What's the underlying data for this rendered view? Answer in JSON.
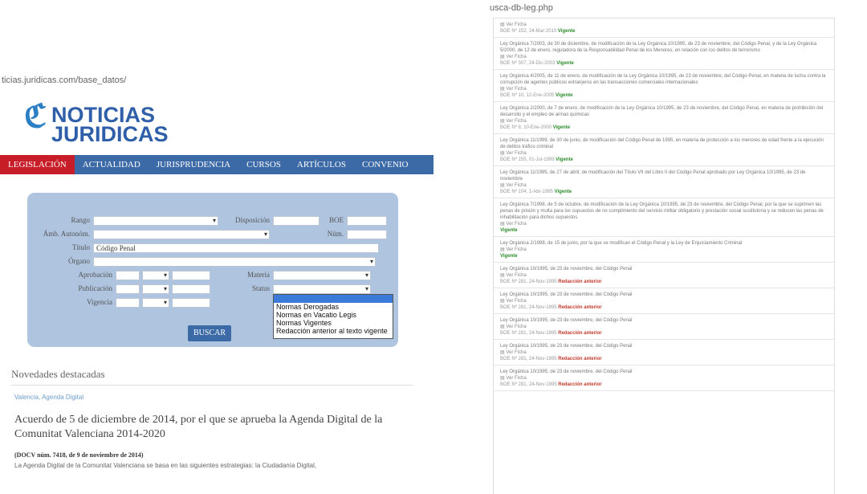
{
  "left_page": {
    "url": "ticias.juridicas.com/base_datos/",
    "logo": {
      "line1": "NOTICIAS",
      "line2": "JURIDICAS"
    },
    "nav": [
      "LEGISLACIÓN",
      "ACTUALIDAD",
      "JURISPRUDENCIA",
      "CURSOS",
      "ARTÍCULOS",
      "CONVENIO"
    ],
    "form": {
      "rango": "Rango",
      "disposicion": "Disposición",
      "boe": "BOE",
      "amb_autonomo": "Ámb. Autonóm.",
      "num": "Núm.",
      "titulo": "Título",
      "titulo_value": "Código Penal",
      "organo": "Órgano",
      "aprobacion": "Aprobación",
      "materia": "Materia",
      "publicacion": "Publicación",
      "status": "Status",
      "vigencia": "Vigencia",
      "status_options": [
        "Normas Derogadas",
        "Normas en Vacatio Legis",
        "Normas Vigentes",
        "Redacción anterior al texto vigente"
      ],
      "search_button": "BUSCAR"
    },
    "news_heading": "Novedades destacadas",
    "tag": "Valencia, Agenda Digital",
    "article_title": "Acuerdo de 5 de diciembre de 2014, por el que se aprueba la Agenda Digital de la Comunitat Valenciana 2014-2020",
    "article_source": "(DOCV núm. 7418, de 9 de noviembre de 2014)",
    "article_excerpt": "La Agenda Digital de la Comunitat Valenciana se basa en las siguientes estrategias: la Ciudadanía Digital,"
  },
  "right_page": {
    "url": "usca-db-leg.php",
    "badge_colors": {
      "vigente": "#2c8c2c",
      "anterior": "#c0392b"
    },
    "entries": [
      {
        "title": "",
        "file": "Ver Ficha",
        "meta": "BOE Nº 152, 24-Mar-2010",
        "badge": "Vigente",
        "badge_type": "vigente"
      },
      {
        "title": "Ley Orgánica 7/2003, de 30 de diciembre, de modificación de la Ley Orgánica 10/1995, de 23 de noviembre, del Código Penal, y de la Ley Orgánica 5/2000, de 12 de enero, reguladora de la Responsabilidad Penal de los Menores, en relación con los delitos de terrorismo",
        "file": "Ver Ficha",
        "meta": "BOE Nº 307, 24-Dic-2003",
        "badge": "Vigente",
        "badge_type": "vigente"
      },
      {
        "title": "Ley Orgánica 4/2005, de 11 de enero, de modificación de la Ley Orgánica 10/1995, de 23 de noviembre, del Código Penal, en materia de lucha contra la corrupción de agentes públicos extranjeros en las transacciones comerciales internacionales",
        "file": "Ver Ficha",
        "meta": "BOE Nº 10, 12-Ene-2005",
        "badge": "Vigente",
        "badge_type": "vigente"
      },
      {
        "title": "Ley Orgánica 2/2000, de 7 de enero, de modificación de la Ley Orgánica 10/1995, de 23 de noviembre, del Código Penal, en materia de prohibición del desarrollo y el empleo de armas químicas",
        "file": "Ver Ficha",
        "meta": "BOE Nº 8, 10-Ene-2000",
        "badge": "Vigente",
        "badge_type": "vigente"
      },
      {
        "title": "Ley Orgánica 11/1999, de 30 de junio, de modificación del Código Penal de 1995, en materia de protección a los menores de edad frente a la ejecución de delitos tráfico criminal",
        "file": "Ver Ficha",
        "meta": "BOE Nº 155, 01-Jul-1999",
        "badge": "Vigente",
        "badge_type": "vigente"
      },
      {
        "title": "Ley Orgánica 11/1995, de 27 de abril, de modificación del Título VII del Libro II del Código Penal aprobado por Ley Orgánica 10/1995, de 23 de noviembre",
        "file": "Ver Ficha",
        "meta": "BOE Nº 104, 1-Abr-1995",
        "badge": "Vigente",
        "badge_type": "vigente"
      },
      {
        "title": "Ley Orgánica 7/1998, de 5 de octubre, de modificación de la Ley Orgánica 10/1995, de 23 de noviembre, del Código Penal, por la que se suprimen las penas de prisión y multa para los supuestos de no cumplimiento del servicio militar obligatorio y prestación social sustitutoria y se reducen las penas de inhabilitación para dichos supuestos",
        "file": "Ver Ficha",
        "meta": "",
        "badge": "Vigente",
        "badge_type": "vigente"
      },
      {
        "title": "Ley Orgánica 2/1998, de 15 de junio, por la que se modifican el Código Penal y la Ley de Enjuiciamiento Criminal",
        "file": "Ver Ficha",
        "meta": "",
        "badge": "Vigente",
        "badge_type": "vigente"
      },
      {
        "title": "Ley Orgánica 10/1995, de 23 de noviembre, del Código Penal",
        "file": "Ver Ficha",
        "meta": "BOE Nº 281, 24-Nov-1995",
        "badge": "Redacción anterior",
        "badge_type": "anterior"
      },
      {
        "title": "Ley Orgánica 10/1995, de 23 de noviembre, del Código Penal",
        "file": "Ver Ficha",
        "meta": "BOE Nº 281, 24-Nov-1995",
        "badge": "Redacción anterior",
        "badge_type": "anterior"
      },
      {
        "title": "Ley Orgánica 10/1995, de 23 de noviembre, del Código Penal",
        "file": "Ver Ficha",
        "meta": "BOE Nº 281, 24-Nov-1995",
        "badge": "Redacción anterior",
        "badge_type": "anterior"
      },
      {
        "title": "Ley Orgánica 10/1995, de 23 de noviembre, del Código Penal",
        "file": "Ver Ficha",
        "meta": "BOE Nº 281, 24-Nov-1995",
        "badge": "Redacción anterior",
        "badge_type": "anterior"
      },
      {
        "title": "Ley Orgánica 10/1995, de 23 de noviembre, del Código Penal",
        "file": "Ver Ficha",
        "meta": "BOE Nº 281, 24-Nov-1995",
        "badge": "Redacción anterior",
        "badge_type": "anterior"
      }
    ]
  }
}
